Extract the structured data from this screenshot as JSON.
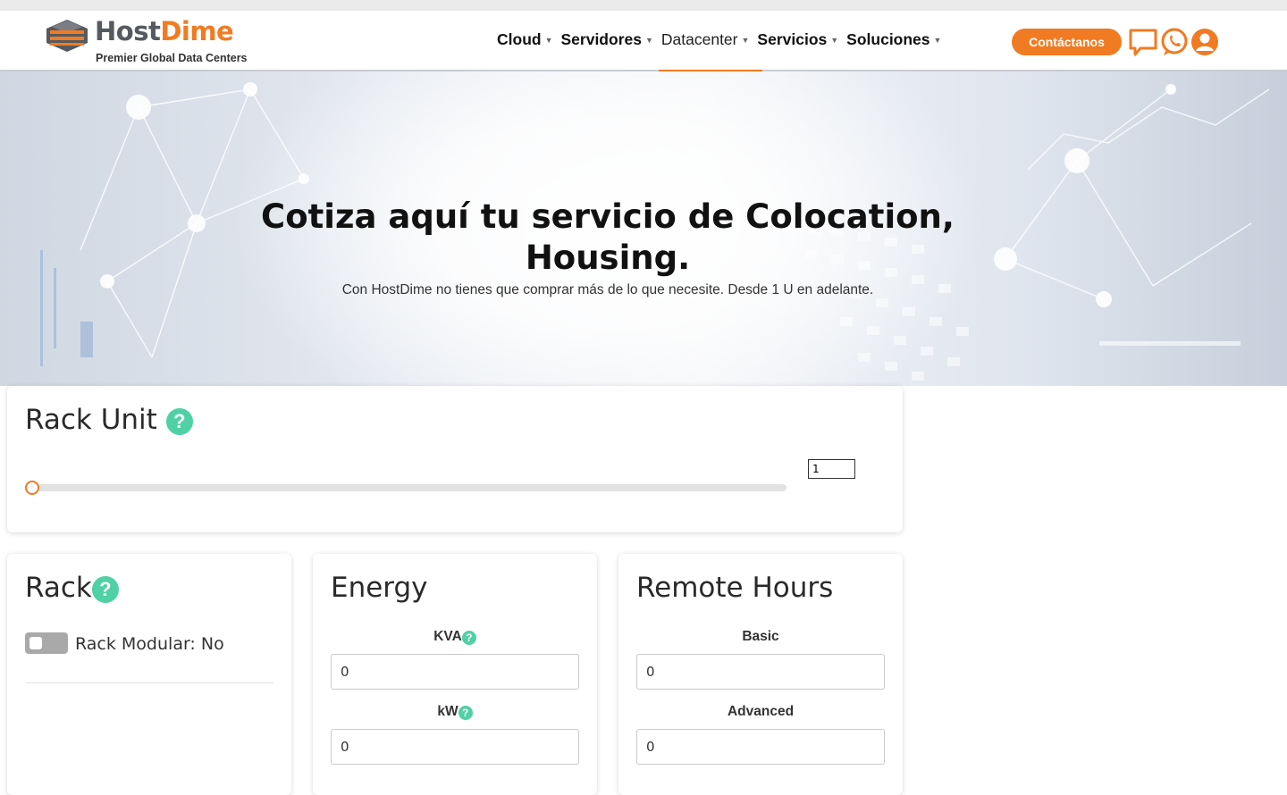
{
  "brand": {
    "name_part1": "Host",
    "name_part2": "Dime",
    "tagline": "Premier Global Data Centers",
    "color_primary": "#f07b22",
    "color_gray": "#555a60"
  },
  "nav": {
    "items": [
      {
        "label": "Cloud"
      },
      {
        "label": "Servidores"
      },
      {
        "label": "Datacenter"
      },
      {
        "label": "Servicios"
      },
      {
        "label": "Soluciones"
      }
    ],
    "active": "Datacenter"
  },
  "header_actions": {
    "contact_label": "Contáctanos",
    "icons": [
      "chat-icon",
      "whatsapp-icon",
      "user-icon"
    ]
  },
  "hero": {
    "title": "Cotiza aquí tu servicio de Colocation, Housing.",
    "subtitle": "Con HostDime no tienes que comprar más de lo que necesite. Desde 1 U en adelante."
  },
  "rack_unit": {
    "title": "Rack Unit",
    "help_icon": "help-icon",
    "value": "1",
    "slider_fraction": 0.0
  },
  "rack": {
    "title": "Rack",
    "help_icon": "help-icon",
    "toggle_label": "Rack Modular: No",
    "toggle_on": false
  },
  "energy": {
    "title": "Energy",
    "kva_label": "KVA",
    "kva_value": "0",
    "kw_label": "kW",
    "kw_value": "0"
  },
  "remote_hours": {
    "title": "Remote Hours",
    "basic_label": "Basic",
    "basic_value": "0",
    "advanced_label": "Advanced",
    "advanced_value": "0"
  },
  "colors": {
    "accent": "#f07b22",
    "help": "#4fd1a5"
  }
}
